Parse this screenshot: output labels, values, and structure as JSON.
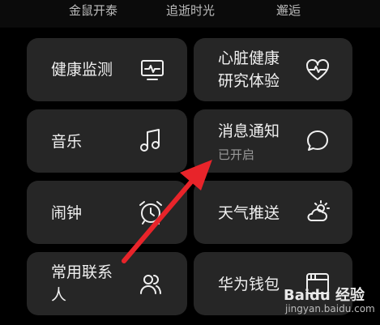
{
  "top_labels": [
    "金鼠开泰",
    "追逝时光",
    "邂逅"
  ],
  "tiles": {
    "health": {
      "label": "健康监测",
      "icon": "monitor-heartbeat-icon"
    },
    "heart_research": {
      "line1": "心脏健康",
      "line2": "研究体验",
      "icon": "heart-pulse-icon"
    },
    "music": {
      "label": "音乐",
      "icon": "music-note-icon"
    },
    "notifications": {
      "label": "消息通知",
      "status": "已开启",
      "icon": "chat-bubble-icon"
    },
    "alarm": {
      "label": "闹钟",
      "icon": "alarm-clock-icon"
    },
    "weather": {
      "label": "天气推送",
      "icon": "weather-icon"
    },
    "contacts": {
      "line1": "常用联系",
      "line2": "人",
      "icon": "contacts-icon"
    },
    "wallet": {
      "label": "华为钱包",
      "icon": "wallet-icon"
    }
  },
  "watermark": {
    "logo": "Baidu 经验",
    "site": "jingyan.baidu.com"
  },
  "colors": {
    "background": "#000000",
    "tile": "#262626",
    "arrow": "#e8242a",
    "text": "#f0f0f0",
    "subtext": "#9a9a9a"
  }
}
